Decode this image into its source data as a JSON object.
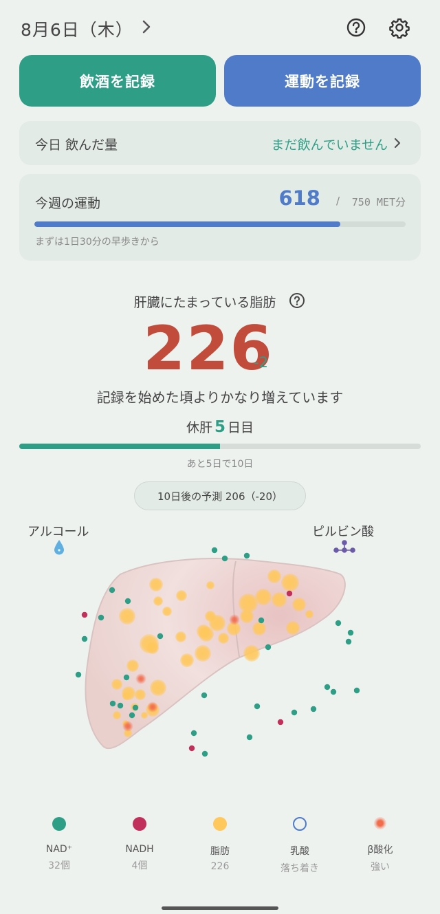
{
  "header": {
    "date": "8月6日（木）"
  },
  "actions": {
    "drink_label": "飲酒を記録",
    "exercise_label": "運動を記録"
  },
  "drink_card": {
    "label": "今日 飲んだ量",
    "value": "まだ飲んでいません"
  },
  "exercise_card": {
    "label": "今週の運動",
    "current": "618",
    "slash": "/",
    "goal": "750 MET分",
    "progress": 0.824,
    "hint": "まずは1日30分の早歩きから"
  },
  "fat": {
    "title": "肝臓にたまっている脂肪",
    "value": "226",
    "delta": "-2",
    "message": "記録を始めた頃よりかなり増えています"
  },
  "rest": {
    "prefix": "休肝",
    "days": "5",
    "suffix": "日目",
    "progress": 0.5,
    "hint": "あと5日で10日"
  },
  "prediction": "10日後の予測 206（-20）",
  "liver": {
    "left_label": "アルコール",
    "right_label": "ピルビン酸"
  },
  "colors": {
    "teal": "#2f9e86",
    "blue": "#4f7bc8",
    "red": "#c24c3b",
    "nadh": "#c0305a",
    "fat": "#ffc85c",
    "lactate": "#4f7bc8",
    "beta": "#f26b4a"
  },
  "legend": [
    {
      "name": "NAD⁺",
      "value": "32個"
    },
    {
      "name": "NADH",
      "value": "4個"
    },
    {
      "name": "脂肪",
      "value": "226"
    },
    {
      "name": "乳酸",
      "value": "落ち着き"
    },
    {
      "name": "β酸化",
      "value": "強い"
    }
  ]
}
